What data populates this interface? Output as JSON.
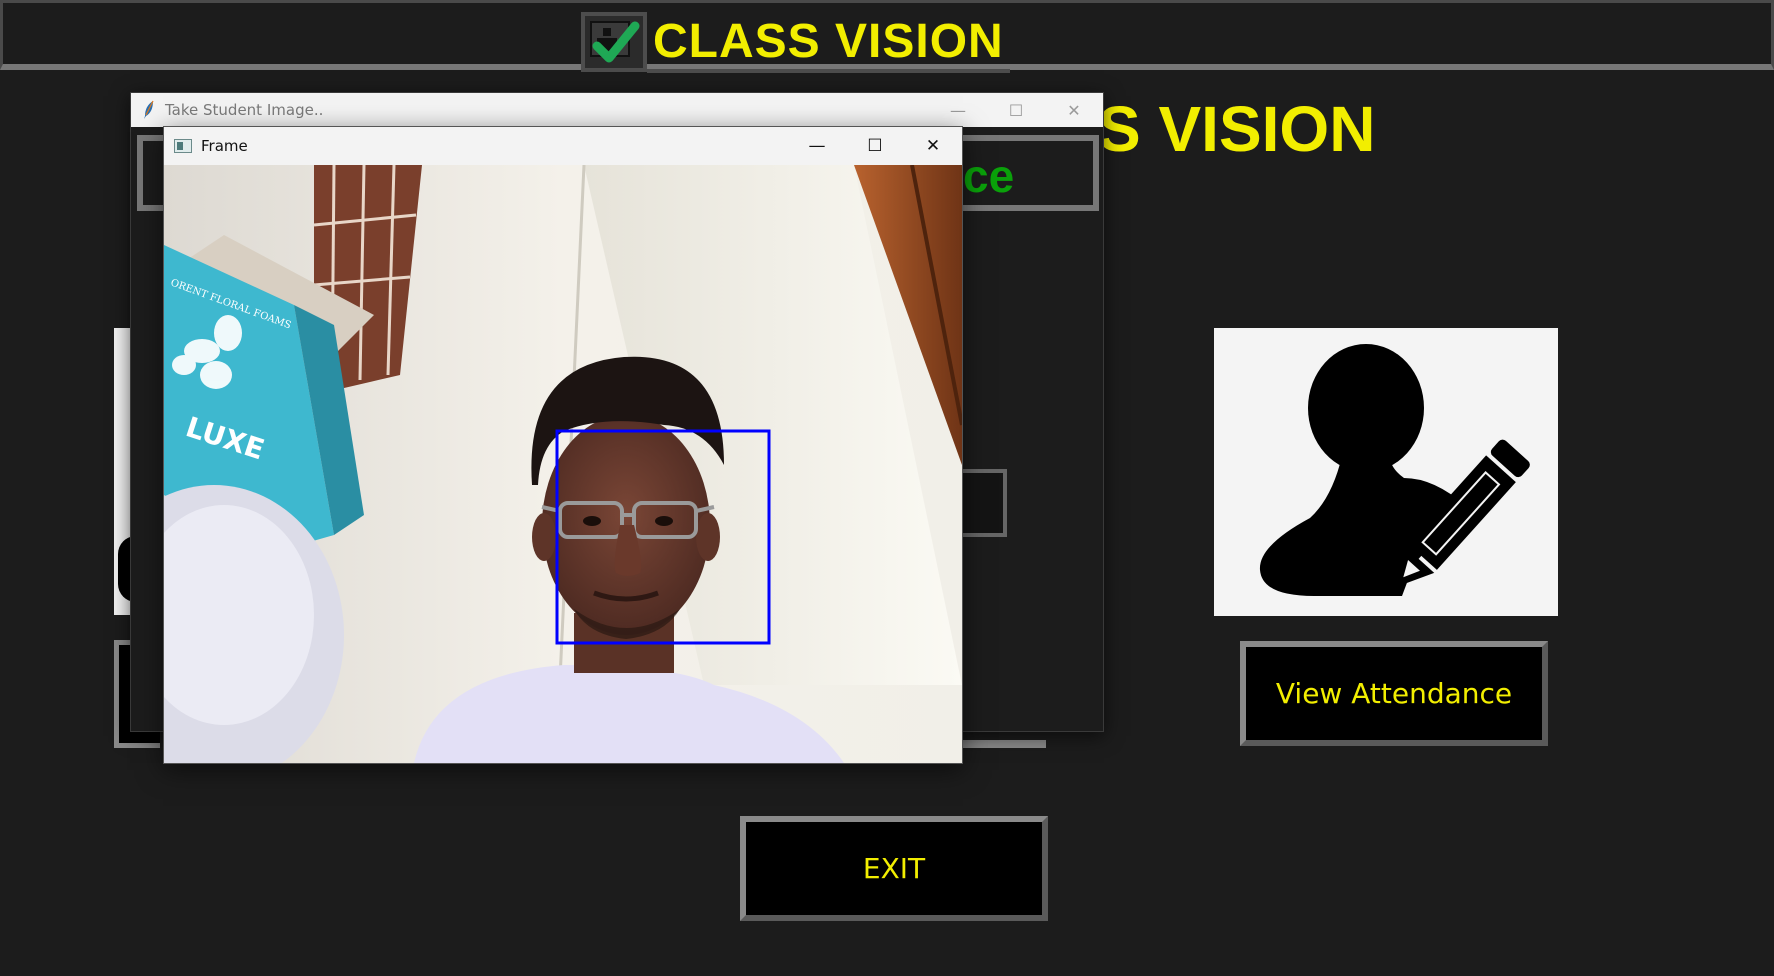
{
  "app": {
    "banner_title": "CLASS VISION",
    "background_title_fragment": "S VISION",
    "view_attendance_label": "View Attendance",
    "exit_label": "EXIT"
  },
  "take_student_image_window": {
    "title": "Take Student Image..",
    "minimize_glyph": "—",
    "maximize_glyph": "☐",
    "close_glyph": "✕",
    "inner_heading_fragment": "ce"
  },
  "frame_window": {
    "title": "Frame",
    "minimize_glyph": "—",
    "maximize_glyph": "☐",
    "close_glyph": "✕",
    "box_label_fragment": "LUXE",
    "box_brand_fragment": "ORENT FLORAL FOAMS"
  },
  "colors": {
    "accent_yellow": "#f2ee00",
    "accent_green": "#0aa10a",
    "background": "#1c1c1c",
    "face_box": "#0000ff"
  },
  "icons": [
    "check-logo-icon",
    "feather-icon",
    "frame-app-icon",
    "user-edit-icon"
  ]
}
